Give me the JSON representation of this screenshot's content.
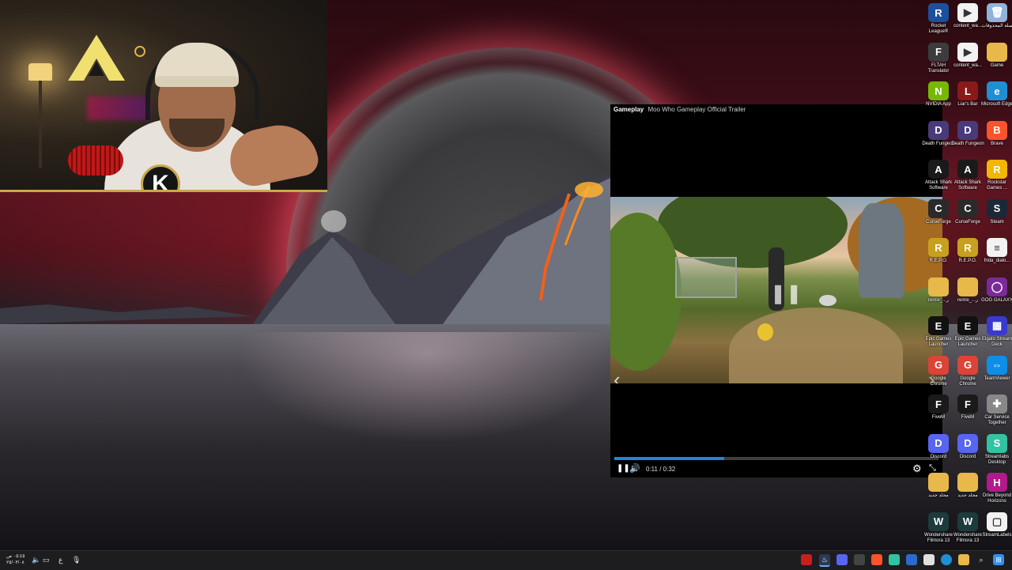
{
  "player": {
    "category": "Gameplay",
    "title": "Moo Who Gameplay Official Trailer",
    "time": "0:11 / 0:32",
    "progress_fraction": 0.34
  },
  "webcam": {
    "badge": "K"
  },
  "desktop_icons_col1": [
    {
      "label": "Rocket League®",
      "icon": "rocket-league-icon",
      "color": "#1c4f9e",
      "glyph": "R"
    },
    {
      "label": "FLTAH Translator",
      "icon": "fltah-translator-icon",
      "color": "#3c3c3c",
      "glyph": "F"
    },
    {
      "label": "NVIDIA App",
      "icon": "nvidia-icon",
      "color": "#76b900",
      "glyph": "N"
    },
    {
      "label": "Death Fungeon",
      "icon": "death-fungeon-icon",
      "color": "#4a3a7a",
      "glyph": "D"
    },
    {
      "label": "Attack Shark Software",
      "icon": "attack-shark-icon",
      "color": "#1a1a1a",
      "glyph": "A"
    },
    {
      "label": "CurseForge",
      "icon": "curseforge-icon",
      "color": "#2a2a2a",
      "glyph": "C"
    },
    {
      "label": "R.E.P.O.",
      "icon": "repo-icon",
      "color": "#c8a020",
      "glyph": "R"
    },
    {
      "label": "remix_...ر",
      "icon": "folder-icon",
      "color": "#e8b84a",
      "glyph": ""
    },
    {
      "label": "Epic Games Launcher",
      "icon": "epic-games-icon",
      "color": "#111111",
      "glyph": "E"
    },
    {
      "label": "Google Chrome",
      "icon": "chrome-icon",
      "color": "#db4437",
      "glyph": "G"
    },
    {
      "label": "FiveM",
      "icon": "fivem-icon",
      "color": "#1a1a1a",
      "glyph": "F"
    },
    {
      "label": "Discord",
      "icon": "discord-icon",
      "color": "#5865f2",
      "glyph": "D"
    },
    {
      "label": "مجلد جديد",
      "icon": "folder-icon",
      "color": "#e8b84a",
      "glyph": ""
    },
    {
      "label": "Wondershare Filmora 13",
      "icon": "filmora-icon",
      "color": "#1d3b3a",
      "glyph": "W"
    }
  ],
  "desktop_icons_col2": [
    {
      "label": "content_wa...",
      "icon": "video-file-icon",
      "color": "#f2f2f2",
      "glyph": "▶"
    },
    {
      "label": "content_wa...",
      "icon": "video-file-icon",
      "color": "#f2f2f2",
      "glyph": "▶"
    },
    {
      "label": "Liar's Bar",
      "icon": "liars-bar-icon",
      "color": "#8a1a1a",
      "glyph": "L"
    },
    {
      "label": "Death Fungeon",
      "icon": "death-fungeon-icon",
      "color": "#4a3a7a",
      "glyph": "D"
    },
    {
      "label": "Attack Shark Software",
      "icon": "attack-shark-icon",
      "color": "#1a1a1a",
      "glyph": "A"
    },
    {
      "label": "CurseForge",
      "icon": "curseforge-icon",
      "color": "#2a2a2a",
      "glyph": "C"
    },
    {
      "label": "R.E.P.O.",
      "icon": "repo-icon",
      "color": "#c8a020",
      "glyph": "R"
    },
    {
      "label": "remix_...ر",
      "icon": "folder-icon",
      "color": "#e8b84a",
      "glyph": ""
    },
    {
      "label": "Epic Games Launcher",
      "icon": "epic-games-icon",
      "color": "#111111",
      "glyph": "E"
    },
    {
      "label": "Google Chrome",
      "icon": "chrome-icon",
      "color": "#db4437",
      "glyph": "G"
    },
    {
      "label": "FiveM",
      "icon": "fivem-icon",
      "color": "#1a1a1a",
      "glyph": "F"
    },
    {
      "label": "Discord",
      "icon": "discord-icon",
      "color": "#5865f2",
      "glyph": "D"
    },
    {
      "label": "مجلد جديد",
      "icon": "folder-icon",
      "color": "#e8b84a",
      "glyph": ""
    },
    {
      "label": "Wondershare Filmora 13",
      "icon": "filmora-icon",
      "color": "#1d3b3a",
      "glyph": "W"
    }
  ],
  "desktop_icons_col3": [
    {
      "label": "سلة المحذوفات",
      "icon": "recycle-bin-icon",
      "color": "#8fb3d9",
      "glyph": "🗑"
    },
    {
      "label": "Game",
      "icon": "folder-icon",
      "color": "#e8b84a",
      "glyph": ""
    },
    {
      "label": "Microsoft Edge",
      "icon": "edge-icon",
      "color": "#1f8fd4",
      "glyph": "e"
    },
    {
      "label": "Brave",
      "icon": "brave-icon",
      "color": "#fb542b",
      "glyph": "B"
    },
    {
      "label": "Rockstar Games ...",
      "icon": "rockstar-icon",
      "color": "#f2b700",
      "glyph": "R"
    },
    {
      "label": "Steam",
      "icon": "steam-icon",
      "color": "#1b2838",
      "glyph": "S"
    },
    {
      "label": "frida_dialo...",
      "icon": "document-icon",
      "color": "#f2f2f2",
      "glyph": "≡"
    },
    {
      "label": "GOG GALAXY",
      "icon": "gog-galaxy-icon",
      "color": "#7a2a9a",
      "glyph": "◯"
    },
    {
      "label": "Elgato Stream Deck",
      "icon": "stream-deck-icon",
      "color": "#3a3ad0",
      "glyph": "▦"
    },
    {
      "label": "TeamViewer",
      "icon": "teamviewer-icon",
      "color": "#0e8ee9",
      "glyph": "⇔"
    },
    {
      "label": "Car Service Together",
      "icon": "car-service-icon",
      "color": "#888888",
      "glyph": "✚"
    },
    {
      "label": "Streamlabs Desktop",
      "icon": "streamlabs-icon",
      "color": "#31c3a2",
      "glyph": "S"
    },
    {
      "label": "Drive Beyond Horizons",
      "icon": "drive-beyond-icon",
      "color": "#b01a8a",
      "glyph": "H"
    },
    {
      "label": "StreamLabels",
      "icon": "streamlabels-icon",
      "color": "#f2f2f2",
      "glyph": "▢"
    }
  ],
  "taskbar": {
    "clock_time": "٠٥:٤٥ ص",
    "clock_date": "٢٥/٠٣/٠٨"
  }
}
